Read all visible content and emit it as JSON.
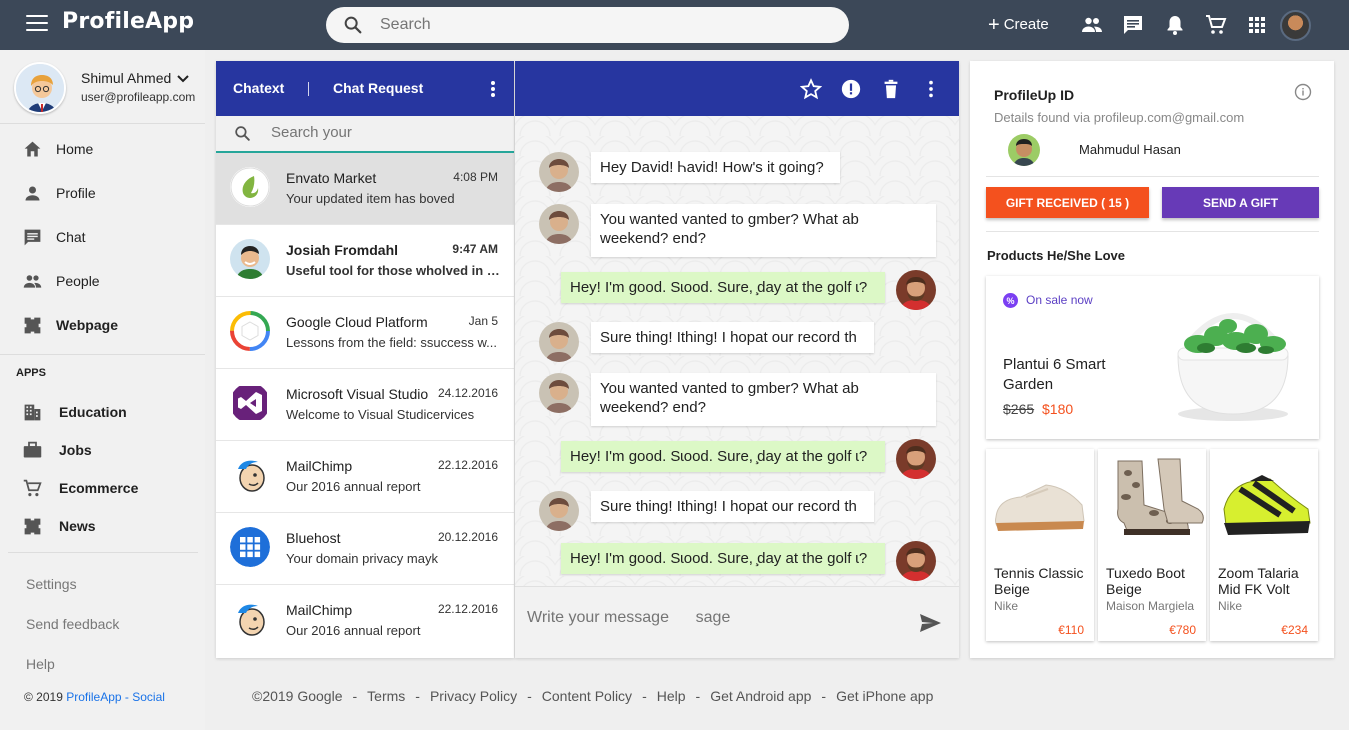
{
  "app": {
    "logo": "ProfileApp",
    "search_placeholder": "Search",
    "create_label": "Create",
    "colors": {
      "topbar": "#3c4858",
      "primary": "#2736a0",
      "accent": "#f4511e",
      "purple": "#673ab7",
      "bubble_out": "#dcf8c6",
      "teal": "#26a69a"
    },
    "top_icons": [
      "people-icon",
      "chat-icon",
      "bell-icon",
      "cart-icon",
      "apps-grid-icon"
    ]
  },
  "sidebar": {
    "user_name": "Shimul Ahmed",
    "user_email": "user@profileapp.com",
    "nav": [
      {
        "label": "Home",
        "icon": "home-icon"
      },
      {
        "label": "Profile",
        "icon": "person-icon"
      },
      {
        "label": "Chat",
        "icon": "chat-icon"
      },
      {
        "label": "People",
        "icon": "people-icon"
      },
      {
        "label": "Webpage",
        "icon": "puzzle-icon"
      }
    ],
    "apps_title": "APPS",
    "apps": [
      {
        "label": "Education",
        "icon": "building-icon"
      },
      {
        "label": "Jobs",
        "icon": "briefcase-icon"
      },
      {
        "label": "Ecommerce",
        "icon": "cart-icon"
      },
      {
        "label": "News",
        "icon": "puzzle-icon"
      }
    ],
    "settings": "Settings",
    "feedback": "Send feedback",
    "help": "Help",
    "copyright_prefix": "© 2019 ",
    "copyright_link": "ProfileApp - Social"
  },
  "chatlist": {
    "tab1": "Chatext",
    "tab2": "Chat Request",
    "search_placeholder": "Search your",
    "conversations": [
      {
        "name": "Envato Market",
        "time": "4:08 PM",
        "message": "Your updated item has boved"
      },
      {
        "name": "Josiah Fromdahl",
        "time": "9:47 AM",
        "message": "Useful tool for those wholved in S..."
      },
      {
        "name": "Google Cloud Platform",
        "time": "Jan 5",
        "message": "Lessons from the field: ssuccess w..."
      },
      {
        "name": "Microsoft Visual Studio",
        "time": "24.12.2016",
        "message": "Welcome to Visual Studicervices"
      },
      {
        "name": "MailChimp",
        "time": "22.12.2016",
        "message": "Our 2016 annual report"
      },
      {
        "name": "Bluehost",
        "time": "20.12.2016",
        "message": "Your domain privacy mayk"
      },
      {
        "name": "MailChimp",
        "time": "22.12.2016",
        "message": "Our 2016 annual report"
      }
    ]
  },
  "chat": {
    "messages": [
      {
        "text": "Hey David! Ꮒavid! How's it going?"
      },
      {
        "text1": "You wanted vanted to gmber? What ab",
        "text2": "weekend?       end?"
      },
      {
        "text": "Hey! I'm good. Sɩood. Sure, ̧day at the golf ɩ?"
      },
      {
        "text": "Sure thing! Ithing! I hopat our record th"
      },
      {
        "text1": "You wanted vanted to gmber? What ab",
        "text2": "weekend?       end?"
      },
      {
        "text": "Hey! I'm good. Sɩood. Sure, ̧day at the golf ɩ?"
      },
      {
        "text": "Sure thing! Ithing! I hopat our record th"
      },
      {
        "text": "Hey! I'm good. Sɩood. Sure, ̧day at the golf ɩ?"
      }
    ],
    "input_placeholder": "Write your message      sage"
  },
  "right": {
    "title": "ProfileUp ID",
    "subtitle": "Details found via profileup.com@gmail.com",
    "user_name": "Mahmudul Hasan",
    "gift_received": "GIFT RECEIVED ( 15 )",
    "send_gift": "SEND A GIFT",
    "products_title": "Products He/She Love",
    "featured": {
      "badge": "On sale now",
      "name": "Plantui 6 Smart Garden",
      "old_price": "$265",
      "new_price": "$180"
    },
    "products": [
      {
        "name": "Tennis Classic Beige",
        "brand": "Nike",
        "price": "€110"
      },
      {
        "name": "Tuxedo Boot Beige",
        "brand": "Maison Margiela",
        "price": "€780"
      },
      {
        "name": "Zoom Talaria Mid FK Volt",
        "brand": "Nike",
        "price": "€234"
      }
    ]
  },
  "footer": {
    "links": [
      "©2019 Google",
      "Terms",
      "Privacy Policy",
      "Content Policy",
      "Help",
      "Get Android app",
      "Get iPhone app"
    ],
    "separator": "-"
  }
}
